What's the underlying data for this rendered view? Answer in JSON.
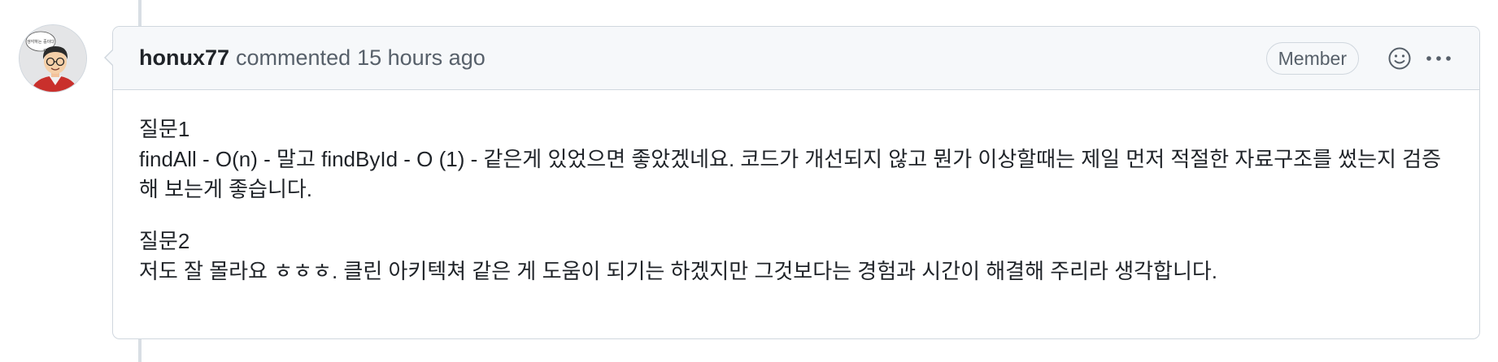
{
  "comment": {
    "author": "honux77",
    "action": "commented",
    "timestamp": "15 hours ago",
    "badge": "Member",
    "avatar_text": "생각하는 중이다",
    "paragraphs": [
      "질문1\nfindAll - O(n) - 말고 findById - O (1) - 같은게 있었으면 좋았겠네요. 코드가 개선되지 않고 뭔가 이상할때는 제일 먼저 적절한 자료구조를 썼는지 검증해 보는게 좋습니다.",
      "질문2\n저도 잘 몰라요 ㅎㅎㅎ. 클린 아키텍쳐 같은 게 도움이 되기는 하겠지만 그것보다는 경험과 시간이 해결해 주리라 생각합니다."
    ]
  },
  "icons": {
    "reaction": "smiley-icon",
    "more": "kebab-horizontal-icon"
  },
  "colors": {
    "border": "#d0d7de",
    "header_bg": "#f6f8fa",
    "muted_text": "#57606a",
    "text": "#1f2328"
  }
}
